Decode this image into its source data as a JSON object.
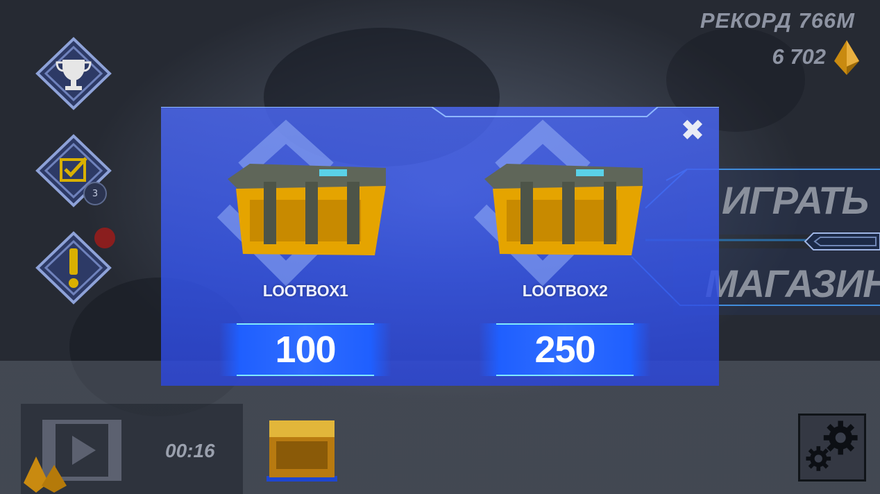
{
  "hud": {
    "record_text": "РЕКОРД 766М",
    "coins_text": "6 702",
    "coin_icon": "amber-crystal-icon"
  },
  "left_menu": {
    "buttons": [
      {
        "name": "trophy-icon"
      },
      {
        "name": "checkbox-icon",
        "badge": "3"
      },
      {
        "name": "exclamation-icon"
      }
    ]
  },
  "right_menu": {
    "play_label": "ИГРАТЬ",
    "shop_label": "МАГАЗИН"
  },
  "bottom": {
    "timer_text": "00:16",
    "video_icon": "video-play-icon",
    "settings_icon": "gear-icon"
  },
  "modal": {
    "close_glyph": "✖",
    "lootboxes": [
      {
        "name": "LOOTBOX1",
        "price": "100"
      },
      {
        "name": "LOOTBOX2",
        "price": "250"
      }
    ]
  },
  "colors": {
    "modal_blue": "#3a5cf0",
    "price_blue": "#2f6dff",
    "accent_cyan": "#7fe9ff",
    "chest_gold": "#e5a400"
  }
}
